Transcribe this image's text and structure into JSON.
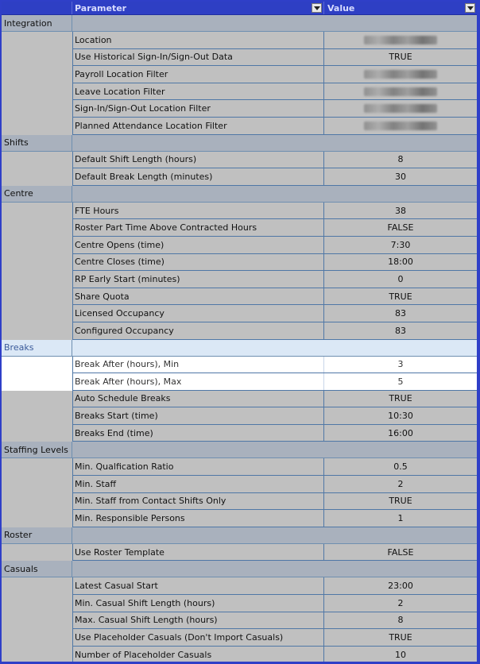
{
  "header": {
    "parameter_label": "Parameter",
    "value_label": "Value"
  },
  "groups": [
    {
      "name": "Integration",
      "rows": [
        {
          "param": "Location",
          "value": "",
          "redacted": true
        },
        {
          "param": "Use Historical Sign-In/Sign-Out Data",
          "value": "TRUE"
        },
        {
          "param": "Payroll Location Filter",
          "value": "",
          "redacted": true
        },
        {
          "param": "Leave Location Filter",
          "value": "",
          "redacted": true
        },
        {
          "param": "Sign-In/Sign-Out Location Filter",
          "value": "",
          "redacted": true
        },
        {
          "param": "Planned Attendance Location Filter",
          "value": "",
          "redacted": true
        }
      ]
    },
    {
      "name": "Shifts",
      "rows": [
        {
          "param": "Default Shift Length (hours)",
          "value": "8"
        },
        {
          "param": "Default Break Length (minutes)",
          "value": "30"
        }
      ]
    },
    {
      "name": "Centre",
      "rows": [
        {
          "param": "FTE Hours",
          "value": "38"
        },
        {
          "param": "Roster Part Time Above Contracted Hours",
          "value": "FALSE"
        },
        {
          "param": "Centre Opens (time)",
          "value": "7:30"
        },
        {
          "param": "Centre Closes (time)",
          "value": "18:00"
        },
        {
          "param": "RP Early Start (minutes)",
          "value": "0"
        },
        {
          "param": "Share Quota",
          "value": "TRUE"
        },
        {
          "param": "Licensed Occupancy",
          "value": "83"
        },
        {
          "param": "Configured Occupancy",
          "value": "83"
        }
      ]
    },
    {
      "name": "Breaks",
      "highlight": true,
      "rows": [
        {
          "param": "Break After (hours), Min",
          "value": "3",
          "hl": true
        },
        {
          "param": "Break After (hours), Max",
          "value": "5",
          "hl": true
        },
        {
          "param": "Auto Schedule Breaks",
          "value": "TRUE"
        },
        {
          "param": "Breaks Start (time)",
          "value": "10:30"
        },
        {
          "param": "Breaks End (time)",
          "value": "16:00"
        }
      ]
    },
    {
      "name": "Staffing Levels",
      "rows": [
        {
          "param": "Min. Qualfication Ratio",
          "value": "0.5"
        },
        {
          "param": "Min. Staff",
          "value": "2"
        },
        {
          "param": "Min. Staff from Contact Shifts Only",
          "value": "TRUE"
        },
        {
          "param": "Min. Responsible Persons",
          "value": "1"
        }
      ]
    },
    {
      "name": "Roster",
      "rows": [
        {
          "param": "Use Roster Template",
          "value": "FALSE"
        }
      ]
    },
    {
      "name": "Casuals",
      "rows": [
        {
          "param": "Latest Casual Start",
          "value": "23:00"
        },
        {
          "param": "Min. Casual Shift Length (hours)",
          "value": "2"
        },
        {
          "param": "Max. Casual Shift Length (hours)",
          "value": "8"
        },
        {
          "param": "Use Placeholder Casuals (Don't Import Casuals)",
          "value": "TRUE"
        },
        {
          "param": "Number of Placeholder Casuals",
          "value": "10"
        }
      ]
    }
  ]
}
